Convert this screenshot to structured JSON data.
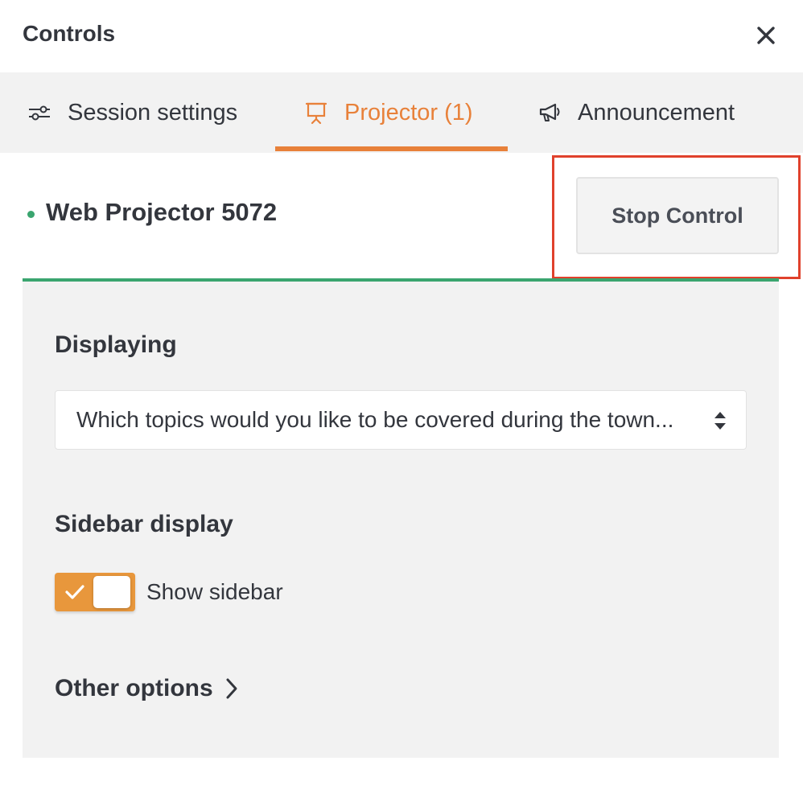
{
  "header": {
    "title": "Controls",
    "close_icon": "close-icon"
  },
  "tabs": [
    {
      "label": "Session settings",
      "icon": "sliders-icon",
      "active": false
    },
    {
      "label": "Projector (1)",
      "icon": "projector-icon",
      "active": true
    },
    {
      "label": "Announcement",
      "icon": "megaphone-icon",
      "active": false
    }
  ],
  "projector": {
    "name": "Web Projector 5072",
    "status_color": "#3aa56f",
    "stop_button_label": "Stop Control"
  },
  "displaying": {
    "title": "Displaying",
    "selected_value": "Which topics would you like to be covered during the town..."
  },
  "sidebar_display": {
    "title": "Sidebar display",
    "toggle_label": "Show sidebar",
    "toggle_on": true
  },
  "other_options": {
    "label": "Other options"
  },
  "colors": {
    "accent": "#e8813a",
    "toggle": "#e8973c",
    "status_green": "#3aa56f",
    "highlight": "#e0412c"
  }
}
